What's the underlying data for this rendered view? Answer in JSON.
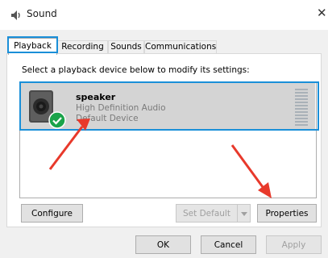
{
  "window": {
    "title": "Sound",
    "close_glyph": "✕"
  },
  "tabs": [
    {
      "label": "Playback",
      "active": true
    },
    {
      "label": "Recording",
      "active": false
    },
    {
      "label": "Sounds",
      "active": false
    },
    {
      "label": "Communications",
      "active": false
    }
  ],
  "instruction": "Select a playback device below to modify its settings:",
  "device": {
    "name": "speaker",
    "description": "High Definition Audio",
    "status": "Default Device",
    "icon": "speaker-icon",
    "badge_icon": "checkmark-icon"
  },
  "buttons": {
    "configure": "Configure",
    "set_default": "Set Default",
    "properties": "Properties",
    "ok": "OK",
    "cancel": "Cancel",
    "apply": "Apply"
  },
  "colors": {
    "highlight": "#1a8fd8",
    "arrow": "#e8392b",
    "default_badge": "#1aa34a",
    "selected_row": "#d4d4d4"
  }
}
